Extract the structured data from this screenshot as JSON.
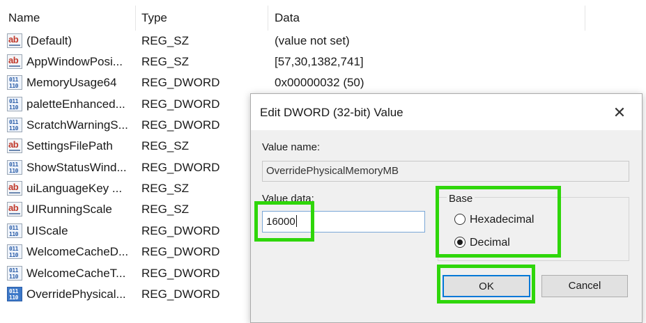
{
  "columns": {
    "name": "Name",
    "type": "Type",
    "data": "Data"
  },
  "rows": [
    {
      "icon": "string-value-icon",
      "name": "(Default)",
      "type": "REG_SZ",
      "data": "(value not set)"
    },
    {
      "icon": "string-value-icon",
      "name": "AppWindowPosi...",
      "type": "REG_SZ",
      "data": "[57,30,1382,741]"
    },
    {
      "icon": "binary-value-icon",
      "name": "MemoryUsage64",
      "type": "REG_DWORD",
      "data": "0x00000032 (50)"
    },
    {
      "icon": "binary-value-icon",
      "name": "paletteEnhanced...",
      "type": "REG_DWORD",
      "data": ""
    },
    {
      "icon": "binary-value-icon",
      "name": "ScratchWarningS...",
      "type": "REG_DWORD",
      "data": ""
    },
    {
      "icon": "string-value-icon",
      "name": "SettingsFilePath",
      "type": "REG_SZ",
      "data": ""
    },
    {
      "icon": "binary-value-icon",
      "name": "ShowStatusWind...",
      "type": "REG_DWORD",
      "data": ""
    },
    {
      "icon": "string-value-icon",
      "name": "uiLanguageKey ...",
      "type": "REG_SZ",
      "data": ""
    },
    {
      "icon": "string-value-icon",
      "name": "UIRunningScale",
      "type": "REG_SZ",
      "data": ""
    },
    {
      "icon": "binary-value-icon",
      "name": "UIScale",
      "type": "REG_DWORD",
      "data": ""
    },
    {
      "icon": "binary-value-icon",
      "name": "WelcomeCacheD...",
      "type": "REG_DWORD",
      "data": ""
    },
    {
      "icon": "binary-value-icon",
      "name": "WelcomeCacheT...",
      "type": "REG_DWORD",
      "data": ""
    },
    {
      "icon": "binary-value-icon",
      "name": "OverridePhysical...",
      "type": "REG_DWORD",
      "data": ""
    }
  ],
  "icon_text": {
    "string": "ab",
    "binary": "011\n110"
  },
  "dialog": {
    "title": "Edit DWORD (32-bit) Value",
    "close_glyph": "✕",
    "value_name_label": "Value name:",
    "value_name": "OverridePhysicalMemoryMB",
    "value_data_label": "Value data:",
    "value_data": "16000",
    "base_label": "Base",
    "options": [
      {
        "label": "Hexadecimal",
        "selected": false
      },
      {
        "label": "Decimal",
        "selected": true
      }
    ],
    "ok_label": "OK",
    "cancel_label": "Cancel"
  },
  "colors": {
    "highlight": "#2fd60a",
    "focus_border": "#0078d7"
  }
}
